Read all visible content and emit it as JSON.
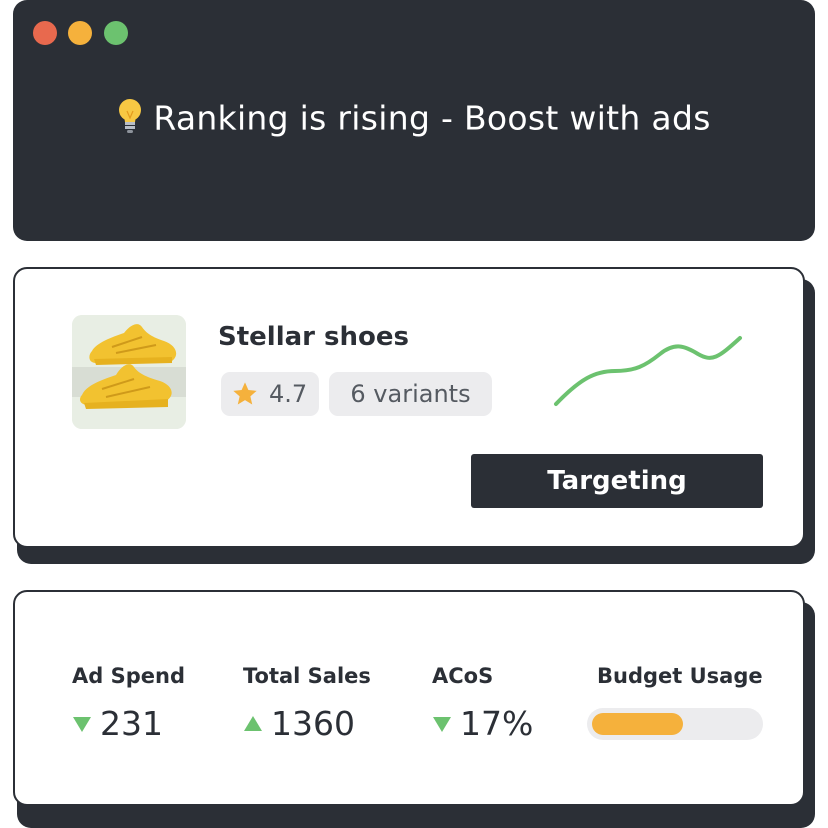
{
  "window": {
    "banner_text": "Ranking is rising - Boost with ads",
    "icon": "lightbulb-icon",
    "controls": [
      "close",
      "minimize",
      "maximize"
    ]
  },
  "product": {
    "name": "Stellar shoes",
    "rating": "4.7",
    "rating_icon": "star-icon",
    "variants": "6 variants",
    "trend_icon": "trend-line-icon",
    "targeting_button": "Targeting"
  },
  "metrics": {
    "ad_spend": {
      "label": "Ad Spend",
      "value": "231",
      "trend": "down"
    },
    "total_sales": {
      "label": "Total Sales",
      "value": "1360",
      "trend": "up"
    },
    "acos": {
      "label": "ACoS",
      "value": "17%",
      "trend": "down"
    },
    "budget_usage": {
      "label": "Budget Usage",
      "fraction": 0.55
    }
  },
  "colors": {
    "dark": "#2b2f36",
    "accent": "#f5b13c",
    "positive": "#6cc26f",
    "close": "#e8694e"
  }
}
